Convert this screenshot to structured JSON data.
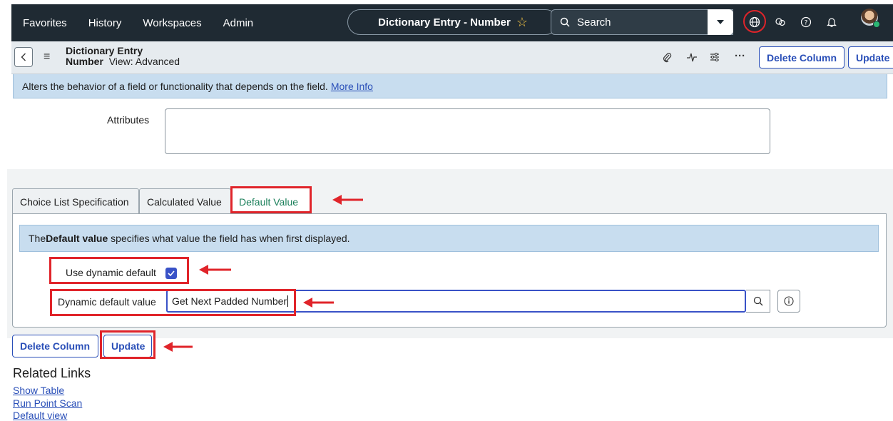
{
  "topnav": {
    "links": [
      "Favorites",
      "History",
      "Workspaces",
      "Admin"
    ],
    "record_title": "Dictionary Entry - Number",
    "star_icon": "☆",
    "search_label": "Search"
  },
  "form_header": {
    "title_line1": "Dictionary Entry",
    "title_line2_bold": "Number",
    "view_label": "View: Advanced",
    "delete_column": "Delete Column",
    "update": "Update"
  },
  "banner": {
    "text": "Alters the behavior of a field or functionality that depends on the field.",
    "link": "More Info"
  },
  "attributes": {
    "label": "Attributes",
    "value": ""
  },
  "tabs": [
    "Choice List Specification",
    "Calculated Value",
    "Default Value"
  ],
  "default_panel": {
    "banner_prefix": "The ",
    "banner_bold": "Default value",
    "banner_suffix": " specifies what value the field has when first displayed.",
    "use_dynamic_label": "Use dynamic default",
    "dynamic_value_label": "Dynamic default value",
    "dynamic_value": "Get Next Padded Number"
  },
  "buttons": {
    "delete_column": "Delete Column",
    "update": "Update"
  },
  "related_links": {
    "title": "Related Links",
    "items": [
      "Show Table",
      "Run Point Scan",
      "Default view"
    ]
  },
  "colors": {
    "nav": "#1f2a33",
    "accent": "#2a4fb8",
    "annotation": "#e0242a"
  }
}
